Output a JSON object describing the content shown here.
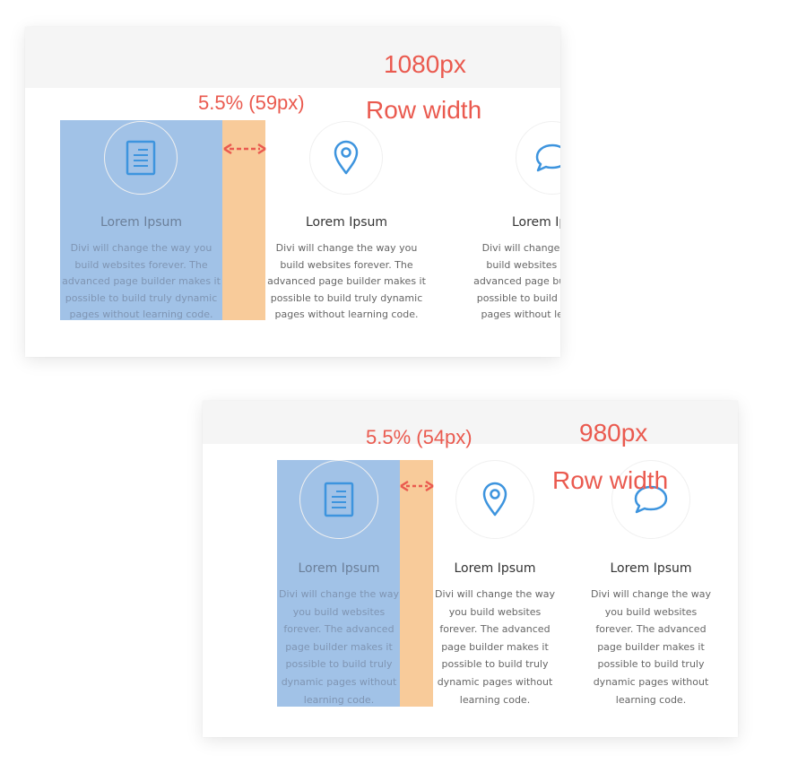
{
  "examples": [
    {
      "row_width_value": "1080px",
      "row_width_label": "Row width",
      "gutter_label": "5.5% (59px)",
      "columns": [
        {
          "icon": "document-icon",
          "title": "Lorem Ipsum",
          "body": "Divi will change the way you build websites forever. The advanced page builder makes it possible to build truly dynamic pages without learning code."
        },
        {
          "icon": "map-pin-icon",
          "title": "Lorem Ipsum",
          "body": "Divi will change the way you build websites forever. The advanced page builder makes it possible to build truly dynamic pages without learning code."
        },
        {
          "icon": "speech-bubble-icon",
          "title": "Lorem Ipsum",
          "body": "Divi will change the way you build websites forever. The advanced page builder makes it possible to build truly dynamic pages without learning code."
        }
      ]
    },
    {
      "row_width_value": "980px",
      "row_width_label": "Row width",
      "gutter_label": "5.5% (54px)",
      "columns": [
        {
          "icon": "document-icon",
          "title": "Lorem Ipsum",
          "body": "Divi will change the way you build websites forever. The advanced page builder makes it possible to build truly dynamic pages without learning code."
        },
        {
          "icon": "map-pin-icon",
          "title": "Lorem Ipsum",
          "body": "Divi will change the way you build websites forever. The advanced page builder makes it possible to build truly dynamic pages without learning code."
        },
        {
          "icon": "speech-bubble-icon",
          "title": "Lorem Ipsum",
          "body": "Divi will change the way you build websites forever. The advanced page builder makes it possible to build truly dynamic pages without learning code."
        }
      ]
    }
  ],
  "colors": {
    "annotation": "#ea5a4f",
    "column_highlight": "#a3c4e8",
    "gutter_highlight": "#f8cb9a",
    "icon": "#3d94de"
  }
}
